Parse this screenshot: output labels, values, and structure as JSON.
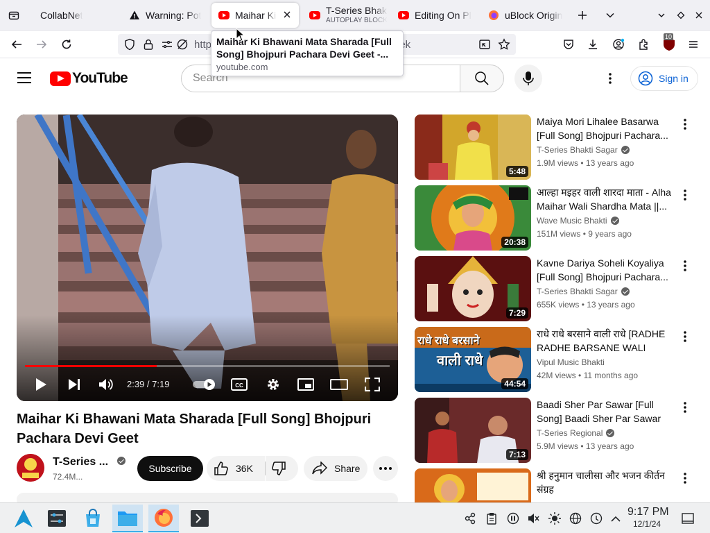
{
  "browser": {
    "tabs": [
      {
        "label": "CollabNet",
        "sub": ""
      },
      {
        "label": "Warning: Pot",
        "sub": ""
      },
      {
        "label": "Maihar Ki",
        "sub": ""
      },
      {
        "label": "T-Series Bhak",
        "sub": "AUTOPLAY BLOCK"
      },
      {
        "label": "Editing On Pl",
        "sub": ""
      },
      {
        "label": "uBlock Origin",
        "sub": ""
      }
    ],
    "url_visible_start": "http",
    "url_visible_end": "eek",
    "tooltip_title": "Maihar Ki Bhawani Mata Sharada [Full Song] Bhojpuri Pachara Devi Geet -...",
    "tooltip_url": "youtube.com",
    "extension_badge": "10"
  },
  "youtube": {
    "logo_text": "YouTube",
    "search_placeholder": "Search",
    "sign_in": "Sign in"
  },
  "player": {
    "time": "2:39 / 7:19",
    "progress_fraction": 0.362
  },
  "video": {
    "title": "Maihar Ki Bhawani Mata Sharada [Full Song] Bhojpuri Pachara Devi Geet",
    "channel": "T-Series ...",
    "subscribers": "72.4M...",
    "subscribe_label": "Subscribe",
    "likes": "36K",
    "share_label": "Share"
  },
  "recommendations": [
    {
      "title": "Maiya Mori Lihalee Basarwa [Full Song] Bhojpuri Pachara...",
      "channel": "T-Series Bhakti Sagar",
      "verified": true,
      "views": "1.9M views",
      "age": "13 years ago",
      "duration": "5:48"
    },
    {
      "title": "आल्हा मइहर वाली शारदा माता - Alha Maihar Wali Shardha Mata ||...",
      "channel": "Wave Music Bhakti",
      "verified": true,
      "views": "151M views",
      "age": "9 years ago",
      "duration": "20:38"
    },
    {
      "title": "Kavne Dariya Soheli Koyaliya [Full Song] Bhojpuri Pachara...",
      "channel": "T-Series Bhakti Sagar",
      "verified": true,
      "views": "655K views",
      "age": "13 years ago",
      "duration": "7:29"
    },
    {
      "title": "राधे राधे बरसाने वाली राधे [RADHE RADHE BARSANE WALI RADH...",
      "channel": "Vipul Music Bhakti",
      "verified": false,
      "views": "42M views",
      "age": "11 months ago",
      "duration": "44:54"
    },
    {
      "title": "Baadi Sher Par Sawar [Full Song] Baadi Sher Par Sawar",
      "channel": "T-Series Regional",
      "verified": true,
      "views": "5.9M views",
      "age": "13 years ago",
      "duration": "7:13"
    },
    {
      "title": "श्री हनुमान चालीसा और भजन कीर्तन संग्रह",
      "channel": "",
      "verified": false,
      "views": "",
      "age": "",
      "duration": ""
    }
  ],
  "thumb_text": {
    "rec4_line1": "राधे राधे बरसाने",
    "rec4_line2": "वाली राधे"
  },
  "taskbar": {
    "time": "9:17 PM",
    "date": "12/1/24"
  },
  "colors": {
    "yt_red": "#ff0000",
    "link_blue": "#065fd4",
    "taskbar_bg": "#eff0f1"
  }
}
